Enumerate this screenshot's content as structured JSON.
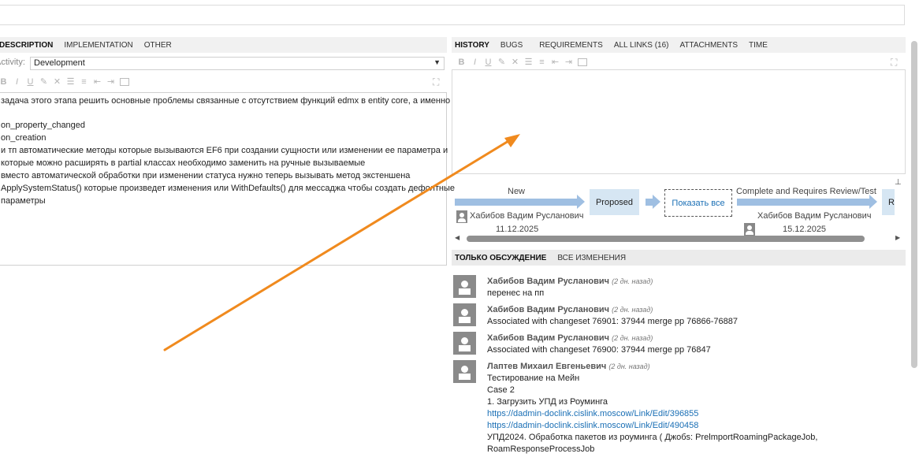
{
  "left_tabs": [
    "DESCRIPTION",
    "IMPLEMENTATION",
    "OTHER"
  ],
  "activity": {
    "label": "Activity:",
    "value": "Development"
  },
  "description_lines": [
    "задача этого этапа решить основные проблемы связанные с отсутствием функций edmx в entity core, а именно",
    "",
    "on_property_changed",
    "on_creation",
    "и тп автоматические методы которые вызываются EF6 при создании сущности или изменении ее параметра и",
    "которые можно расширять в partial классах необходимо заменить на ручные вызываемые",
    "вместо автоматической обработки при изменении статуса нужно теперь вызывать метод экстеншена",
    "ApplySystemStatus() которые произведет изменения или WithDefaults() для мессаджа чтобы создать дефолтные",
    "параметры"
  ],
  "right_tabs": [
    "HISTORY",
    "BUGS",
    "REQUIREMENTS",
    "ALL LINKS (16)",
    "ATTACHMENTS",
    "TIME"
  ],
  "workflow": {
    "step1_label": "New",
    "state1": "Proposed",
    "show_all": "Показать все",
    "step2_label": "Complete and Requires Review/Test",
    "state2_partial": "Reso",
    "user1": "Хабибов Вадим Русланович",
    "date1": "11.12.2025",
    "user2": "Хабибов Вадим Русланович",
    "date2": "15.12.2025"
  },
  "discussion_tabs": [
    "ТОЛЬКО ОБСУЖДЕНИЕ",
    "ВСЕ ИЗМЕНЕНИЯ"
  ],
  "comments": [
    {
      "author": "Хабибов Вадим Русланович",
      "time": "(2 дн. назад)",
      "lines": [
        "перенес на пп"
      ]
    },
    {
      "author": "Хабибов Вадим Русланович",
      "time": "(2 дн. назад)",
      "lines": [
        "Associated with changeset 76901: 37944 merge pp 76866-76887"
      ]
    },
    {
      "author": "Хабибов Вадим Русланович",
      "time": "(2 дн. назад)",
      "lines": [
        "Associated with changeset 76900: 37944 merge pp 76847"
      ]
    },
    {
      "author": "Лаптев Михаил Евгеньевич",
      "time": "(2 дн. назад)",
      "lines": [
        "Тестирование на Мейн",
        "Case 2",
        "1. Загрузить УПД из Роуминга"
      ],
      "links": [
        "https://dadmin-doclink.cislink.moscow/Link/Edit/396855",
        "https://dadmin-doclink.cislink.moscow/Link/Edit/490458"
      ],
      "after": [
        "УПД2024. Обработка пакетов из роуминга ( Джобs: PrelmportRoamingPackageJob,",
        "RoamResponseProcessJob"
      ]
    }
  ],
  "colors": {
    "annotation_arrow": "#f08a1e",
    "link": "#1a6fb5",
    "state_fill": "#d6e6f3",
    "arrow_fill": "#9fbfe2"
  }
}
